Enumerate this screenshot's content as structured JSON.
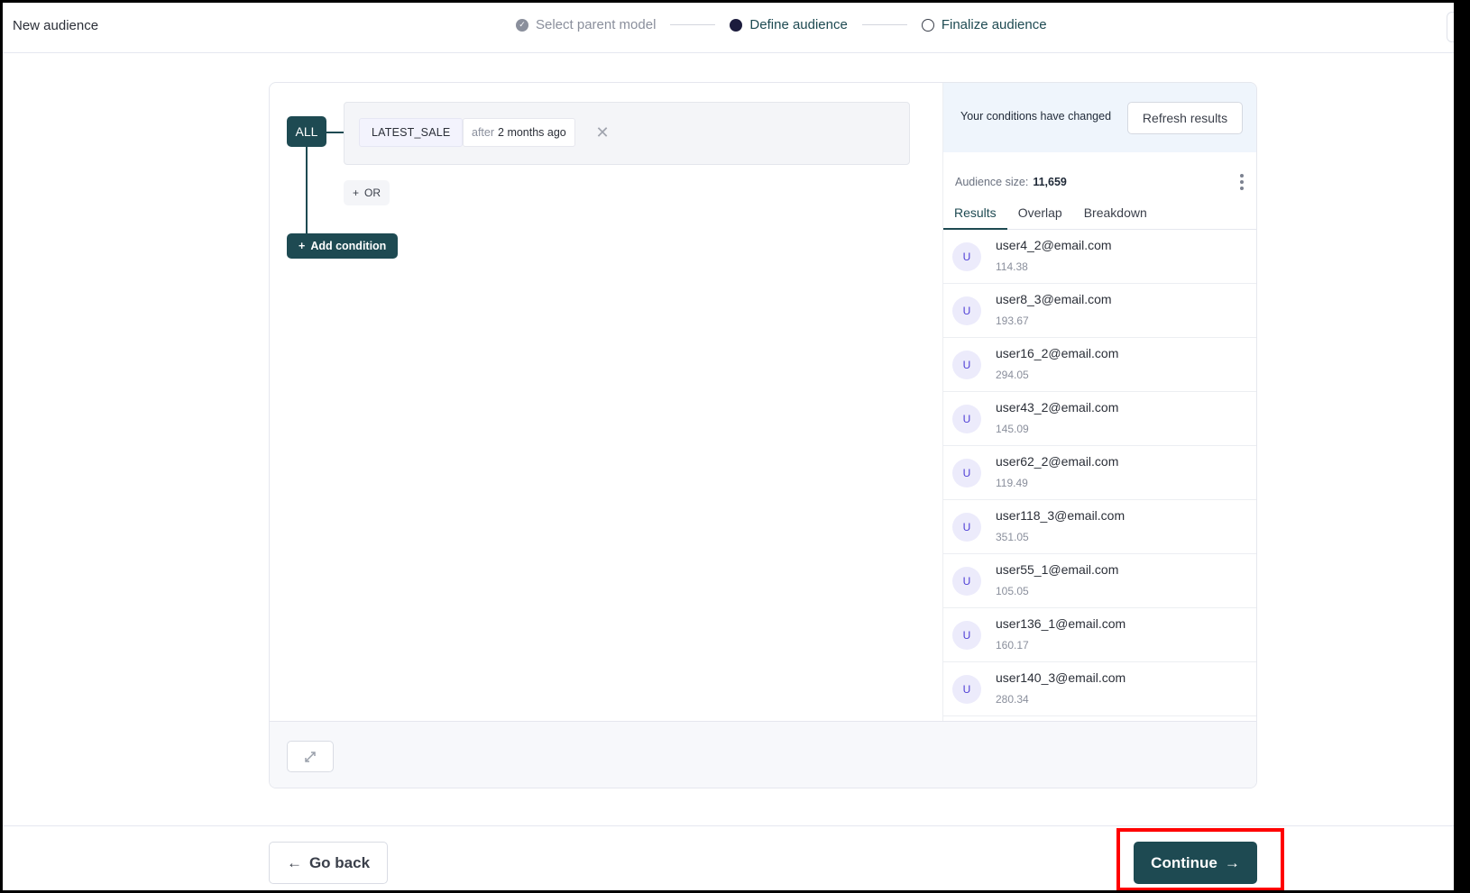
{
  "header": {
    "title": "New audience",
    "steps": [
      {
        "label": "Select parent model",
        "state": "done",
        "icon": "check-circle-icon"
      },
      {
        "label": "Define audience",
        "state": "active",
        "icon": "filled-circle-icon"
      },
      {
        "label": "Finalize audience",
        "state": "todo",
        "icon": "empty-circle-icon"
      }
    ]
  },
  "builder": {
    "group_operator": "ALL",
    "condition": {
      "property": "LATEST_SALE",
      "operator": "after",
      "value": "2 months ago",
      "remove_icon": "close-icon"
    },
    "or_button": {
      "icon": "plus",
      "label": "OR"
    },
    "add_condition_button": {
      "icon": "plus",
      "label": "Add condition"
    }
  },
  "panel": {
    "changed_notice": "Your conditions have changed",
    "refresh_button": "Refresh results",
    "audience_size_label": "Audience size:",
    "audience_size_value": "11,659",
    "tabs": [
      {
        "label": "Results",
        "active": true
      },
      {
        "label": "Overlap",
        "active": false
      },
      {
        "label": "Breakdown",
        "active": false
      }
    ],
    "results": [
      {
        "avatar": "U",
        "email": "user4_2@email.com",
        "amount": "114.38"
      },
      {
        "avatar": "U",
        "email": "user8_3@email.com",
        "amount": "193.67"
      },
      {
        "avatar": "U",
        "email": "user16_2@email.com",
        "amount": "294.05"
      },
      {
        "avatar": "U",
        "email": "user43_2@email.com",
        "amount": "145.09"
      },
      {
        "avatar": "U",
        "email": "user62_2@email.com",
        "amount": "119.49"
      },
      {
        "avatar": "U",
        "email": "user118_3@email.com",
        "amount": "351.05"
      },
      {
        "avatar": "U",
        "email": "user55_1@email.com",
        "amount": "105.05"
      },
      {
        "avatar": "U",
        "email": "user136_1@email.com",
        "amount": "160.17"
      },
      {
        "avatar": "U",
        "email": "user140_3@email.com",
        "amount": "280.34"
      }
    ]
  },
  "footer": {
    "back_button": {
      "icon": "←",
      "label": "Go back"
    },
    "continue_button": {
      "icon": "→",
      "label": "Continue"
    }
  },
  "colors": {
    "brand": "#1e4a52",
    "highlight": "#ff0000",
    "avatar_bg": "#ecebfb",
    "avatar_text": "#4f3fd6",
    "notice_bg": "#eff5fc"
  }
}
